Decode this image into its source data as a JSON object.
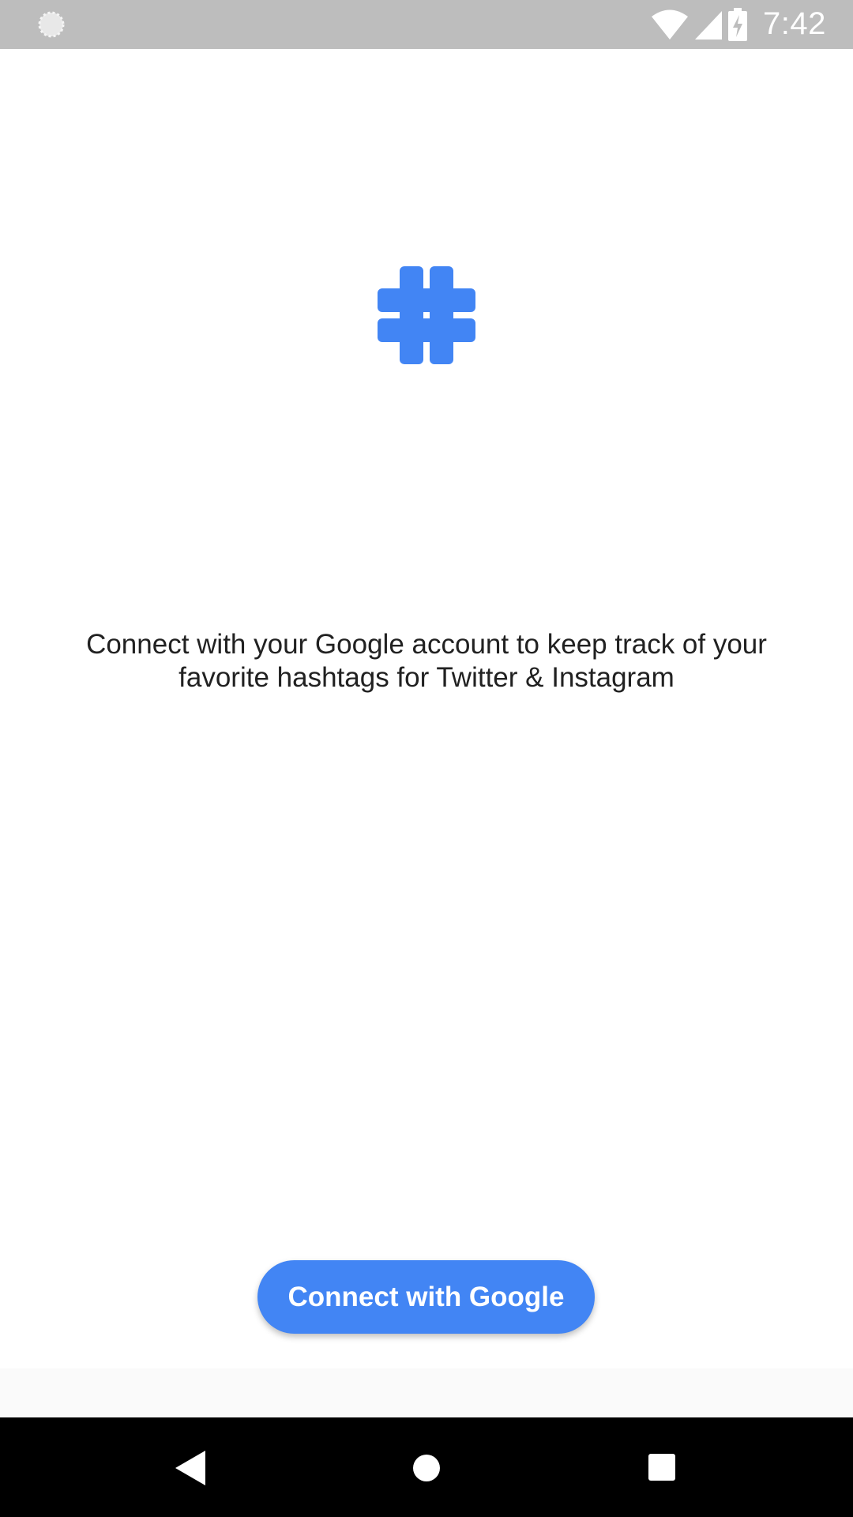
{
  "status_bar": {
    "time": "7:42",
    "icons": [
      "loading-icon",
      "wifi-icon",
      "signal-icon",
      "battery-charging-icon"
    ]
  },
  "main": {
    "logo_icon": "hashtag-icon",
    "description": "Connect with your Google account to keep track of your favorite hashtags for Twitter & Instagram",
    "connect_button_label": "Connect with Google"
  },
  "nav_bar": {
    "icons": [
      "back-icon",
      "home-icon",
      "recents-icon"
    ]
  },
  "colors": {
    "accent": "#4285f4",
    "status_bar": "#bdbdbd",
    "nav_bar": "#000000",
    "text": "#212121"
  }
}
